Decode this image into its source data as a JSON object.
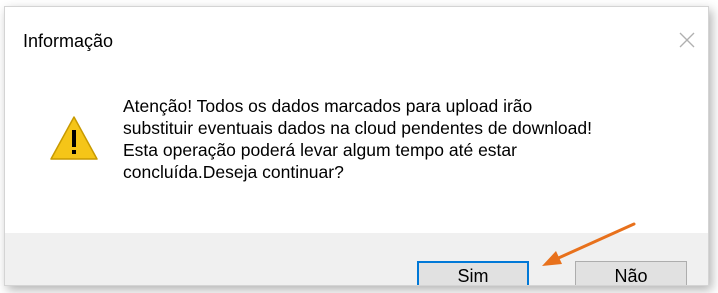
{
  "dialog": {
    "title": "Informação",
    "message": "Atenção! Todos os dados marcados para upload irão\nsubstituir eventuais dados na cloud pendentes de download!\nEsta operação poderá levar algum tempo até estar\nconcluída.Deseja continuar?",
    "icon": "warning-icon",
    "buttons": {
      "yes_label": "Sim",
      "no_label": "Não"
    }
  },
  "colors": {
    "warning_fill": "#f5c518",
    "focus_border": "#0078d7",
    "annotation_arrow": "#e8711c",
    "footer_bg": "#f0f0f0"
  }
}
